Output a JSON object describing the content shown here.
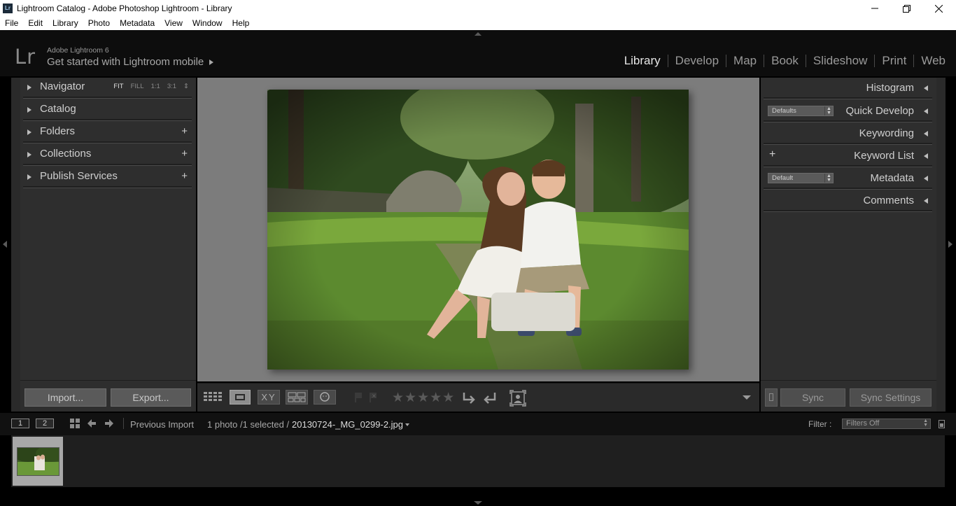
{
  "window": {
    "app_icon_text": "Lr",
    "title": "Lightroom Catalog - Adobe Photoshop Lightroom - Library",
    "controls": [
      "minimize-icon",
      "restore-icon",
      "close-icon"
    ]
  },
  "menu": [
    "File",
    "Edit",
    "Library",
    "Photo",
    "Metadata",
    "View",
    "Window",
    "Help"
  ],
  "identity": {
    "logo": "Lr",
    "version": "Adobe Lightroom 6",
    "mobile_prompt": "Get started with Lightroom mobile"
  },
  "modules": [
    {
      "label": "Library",
      "active": true
    },
    {
      "label": "Develop",
      "active": false
    },
    {
      "label": "Map",
      "active": false
    },
    {
      "label": "Book",
      "active": false
    },
    {
      "label": "Slideshow",
      "active": false
    },
    {
      "label": "Print",
      "active": false
    },
    {
      "label": "Web",
      "active": false
    }
  ],
  "left_panel": {
    "navigator": {
      "label": "Navigator",
      "zoom_options": [
        "FIT",
        "FILL",
        "1:1",
        "3:1"
      ],
      "zoom_selected": "FIT"
    },
    "sections": [
      {
        "label": "Catalog",
        "has_add": false
      },
      {
        "label": "Folders",
        "has_add": true
      },
      {
        "label": "Collections",
        "has_add": true
      },
      {
        "label": "Publish Services",
        "has_add": true
      }
    ],
    "import_label": "Import...",
    "export_label": "Export..."
  },
  "right_panel": {
    "sections": [
      {
        "label": "Histogram"
      },
      {
        "label": "Quick Develop",
        "preset": "Defaults"
      },
      {
        "label": "Keywording"
      },
      {
        "label": "Keyword List",
        "has_add": true
      },
      {
        "label": "Metadata",
        "preset": "Default"
      },
      {
        "label": "Comments"
      }
    ],
    "sync_label": "Sync",
    "sync_settings_label": "Sync Settings"
  },
  "toolbar": {
    "view_modes": [
      "grid-view-icon",
      "loupe-view-icon",
      "compare-view-icon",
      "survey-view-icon",
      "people-view-icon"
    ],
    "compare_text": "XY",
    "rating_stars": 5,
    "rating_value": 0
  },
  "filmstrip_bar": {
    "screen_primary": "1",
    "screen_secondary": "2",
    "source": "Previous Import",
    "selection": "1 photo /1 selected /",
    "filename": "20130724-_MG_0299-2.jpg",
    "filter_label": "Filter :",
    "filter_value": "Filters Off"
  },
  "colors": {
    "panel_bg": "#2e2e2e",
    "center_bg": "#7c7c7c",
    "active_module": "#e6e6e6",
    "inactive_module": "#9a9a9a"
  }
}
